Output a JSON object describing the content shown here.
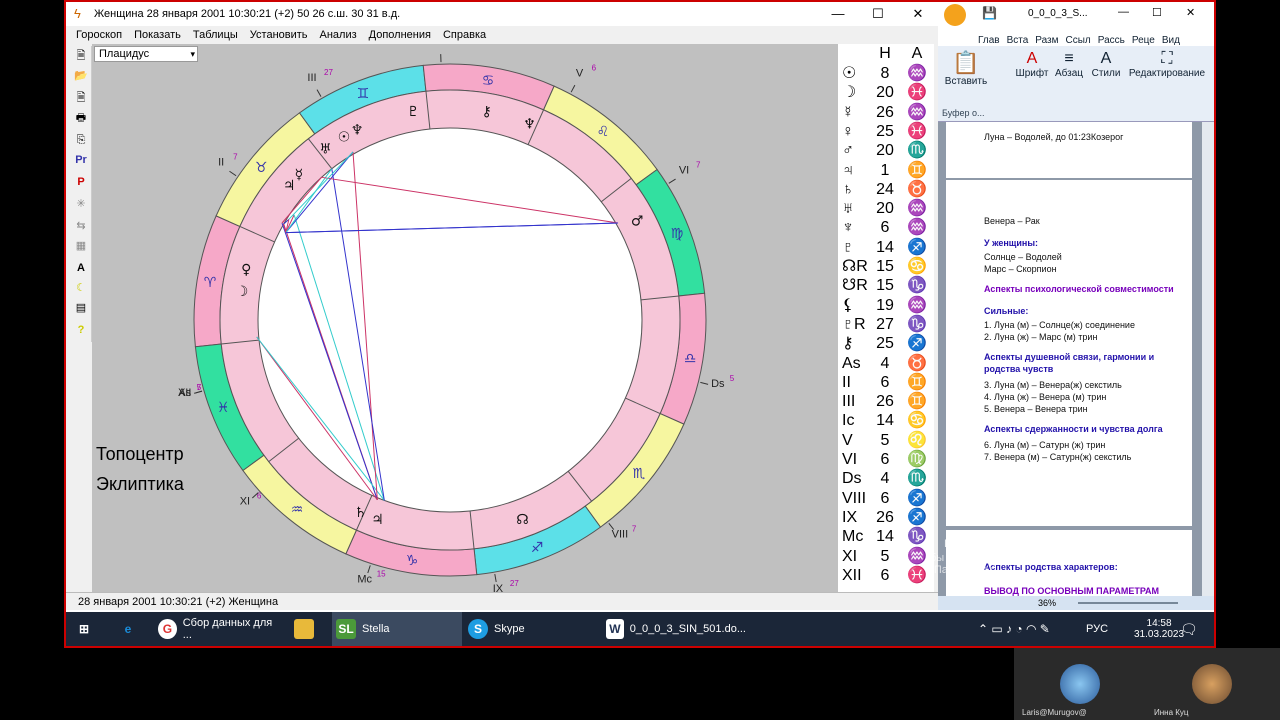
{
  "stella": {
    "title": "Женщина 28 января 2001 10:30:21 (+2)    50 26 с.ш.   30 31 в.д.",
    "menu": [
      "Гороскоп",
      "Показать",
      "Таблицы",
      "Установить",
      "Анализ",
      "Дополнения",
      "Справка"
    ],
    "house_system": "Плацидус",
    "label_topocenter": "Топоцентр",
    "label_ecliptic": "Эклиптика",
    "planet_header": [
      "",
      "Н",
      "А"
    ],
    "planets": [
      {
        "g": "☉",
        "n": "8",
        "z": "♒"
      },
      {
        "g": "☽",
        "n": "20",
        "z": "♓"
      },
      {
        "g": "☿",
        "n": "26",
        "z": "♒"
      },
      {
        "g": "♀",
        "n": "25",
        "z": "♓"
      },
      {
        "g": "♂",
        "n": "20",
        "z": "♏"
      },
      {
        "g": "♃",
        "n": "1",
        "z": "♊"
      },
      {
        "g": "♄",
        "n": "24",
        "z": "♉"
      },
      {
        "g": "♅",
        "n": "20",
        "z": "♒"
      },
      {
        "g": "♆",
        "n": "6",
        "z": "♒"
      },
      {
        "g": "♇",
        "n": "14",
        "z": "♐"
      },
      {
        "g": "☊R",
        "n": "15",
        "z": "♋"
      },
      {
        "g": "☋R",
        "n": "15",
        "z": "♑"
      },
      {
        "g": "⚸",
        "n": "19",
        "z": "♒"
      },
      {
        "g": "♇R",
        "n": "27",
        "z": "♑"
      },
      {
        "g": "⚷",
        "n": "25",
        "z": "♐"
      },
      {
        "g": "As",
        "n": "4",
        "z": "♉"
      },
      {
        "g": "II",
        "n": "6",
        "z": "♊"
      },
      {
        "g": "III",
        "n": "26",
        "z": "♊"
      },
      {
        "g": "Ic",
        "n": "14",
        "z": "♋"
      },
      {
        "g": "V",
        "n": "5",
        "z": "♌"
      },
      {
        "g": "VI",
        "n": "6",
        "z": "♍"
      },
      {
        "g": "Ds",
        "n": "4",
        "z": "♏"
      },
      {
        "g": "VIII",
        "n": "6",
        "z": "♐"
      },
      {
        "g": "IX",
        "n": "26",
        "z": "♐"
      },
      {
        "g": "Mc",
        "n": "14",
        "z": "♑"
      },
      {
        "g": "XI",
        "n": "5",
        "z": "♒"
      },
      {
        "g": "XII",
        "n": "6",
        "z": "♓"
      }
    ],
    "status": "28 января 2001  10:30:21 (+2)   Женщина",
    "houses": [
      "Mc",
      "XI",
      "XII",
      "As",
      "II",
      "III",
      "Ic",
      "V",
      "VI",
      "Ds",
      "VIII",
      "IX"
    ],
    "house_deg": [
      "15",
      "6",
      "7",
      "5",
      "7",
      "27",
      "15",
      "6",
      "7",
      "5",
      "7",
      "27"
    ]
  },
  "word": {
    "title": "0_0_0_3_S...",
    "tabs": [
      "Глав",
      "Вста",
      "Разм",
      "Ссыл",
      "Рассь",
      "Реце",
      "Вид"
    ],
    "groups": [
      "Вставить",
      "Шрифт",
      "Абзац",
      "Стили",
      "Редактирование"
    ],
    "clipboard": "Буфер о...",
    "page1": "Луна – Водолей, до 01:23Козерог",
    "lines": [
      {
        "t": "Венера – Рак",
        "c": ""
      },
      {
        "t": "У женщины:",
        "c": "h"
      },
      {
        "t": "Солнце – Водолей",
        "c": ""
      },
      {
        "t": "Марс – Скорпион",
        "c": ""
      },
      {
        "t": "Аспекты психологической совместимости",
        "c": "p"
      },
      {
        "t": "Сильные:",
        "c": "h"
      },
      {
        "t": "1. Луна (м) – Солнце(ж) соединение",
        "c": ""
      },
      {
        "t": "2. Луна (ж) – Марс (м) трин",
        "c": ""
      },
      {
        "t": "Аспекты душевной связи, гармонии и",
        "c": "h"
      },
      {
        "t": "родства чувств",
        "c": "h"
      },
      {
        "t": "3. Луна (м) – Венера(ж) секстиль",
        "c": ""
      },
      {
        "t": "4. Луна (ж) – Венера (м) трин",
        "c": ""
      },
      {
        "t": "5. Венера – Венера трин",
        "c": ""
      },
      {
        "t": "Аспекты сдержанности и чувства долга",
        "c": "h"
      },
      {
        "t": "6. Луна (м) – Сатурн (ж) трин",
        "c": ""
      },
      {
        "t": "7. Венера (м) – Сатурн(ж) секстиль",
        "c": ""
      }
    ],
    "page3a": "Аспекты родства характеров:",
    "page3b": "ВЫВОД  ПО  ОСНОВНЫМ  ПАРАМЕТРАМ",
    "watermark": "ивация Windows",
    "watermark2": "бы активировать Windows, перейдите в раздел \"Параметры\".",
    "zoom": "36%"
  },
  "taskbar": {
    "chrome": "Сбор данных для ...",
    "stella": "Stella",
    "skype": "Skype",
    "word": "0_0_0_3_SIN_501.do...",
    "lang": "РУС",
    "time": "14:58",
    "date": "31.03.2023"
  },
  "video": {
    "p1": "Laris@Murugov@",
    "p2": "Инна Куц"
  }
}
